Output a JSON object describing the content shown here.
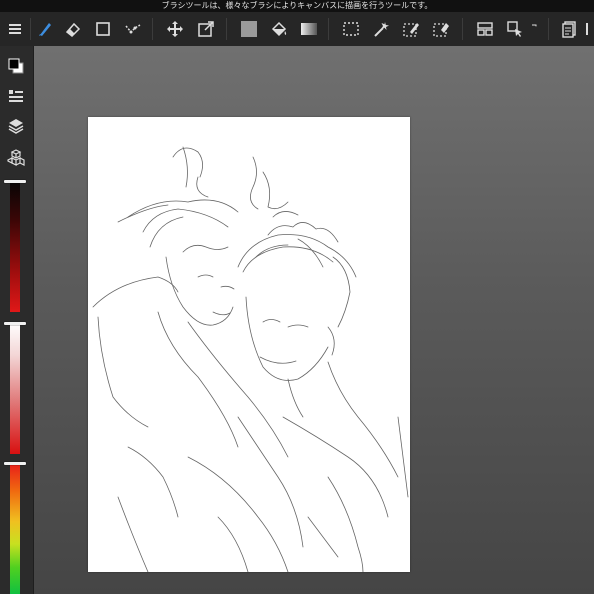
{
  "hint_text": "ブラシツールは、様々なブラシによりキャンバスに描画を行うツールです。",
  "toolbar": {
    "items": [
      "menu-icon",
      "brush-icon",
      "eraser-icon",
      "rectangle-icon",
      "snap-icon",
      "move-icon",
      "transform-icon",
      "fill-color-icon",
      "bucket-icon",
      "gradient-icon",
      "selection-icon",
      "magic-wand-icon",
      "select-pen-icon",
      "select-eraser-icon",
      "layout-icon",
      "select-tool-icon",
      "text-icon",
      "pages-icon"
    ]
  },
  "sidebar": {
    "items": [
      "color-swatch-icon",
      "layer-list-icon",
      "layers-icon",
      "material-icon"
    ],
    "brush_size_level": 0.0,
    "opacity_level": 0.0,
    "hue_level": 0.0
  },
  "colors": {
    "accent": "#3d8ee0",
    "toolbar_bg": "#262626",
    "workspace_top": "#707070",
    "workspace_bottom": "#454545",
    "slider_red": "#e01a1a"
  }
}
